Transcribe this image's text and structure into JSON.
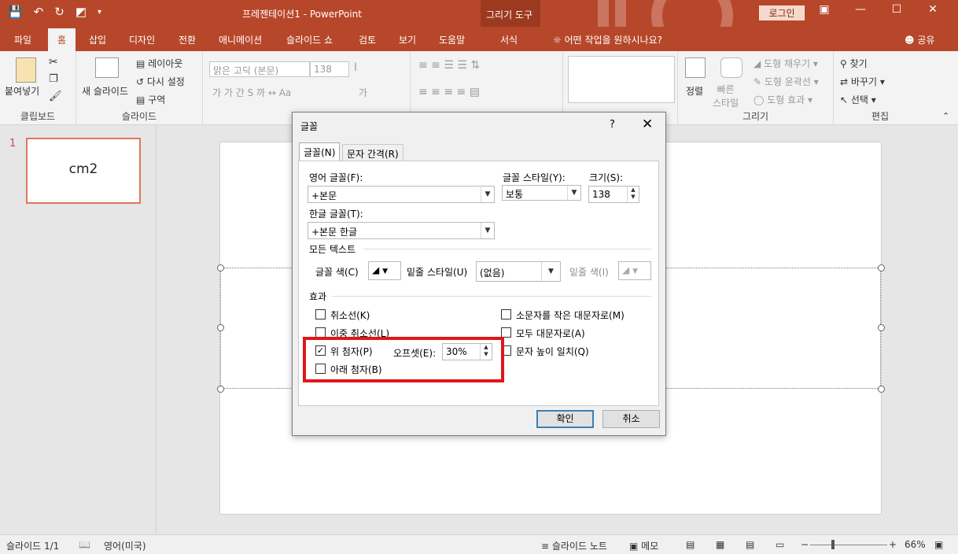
{
  "window": {
    "doc_title": "프레젠테이션1 - PowerPoint",
    "context_tab_group": "그리기 도구",
    "login_label": "로그인"
  },
  "tabs": [
    {
      "label": "파일"
    },
    {
      "label": "홈"
    },
    {
      "label": "삽입"
    },
    {
      "label": "디자인"
    },
    {
      "label": "전환"
    },
    {
      "label": "애니메이션"
    },
    {
      "label": "슬라이드 쇼"
    },
    {
      "label": "검토"
    },
    {
      "label": "보기"
    },
    {
      "label": "도움말"
    },
    {
      "label": "서식"
    }
  ],
  "tell_me": "어떤 작업을 원하시나요?",
  "share_label": "공유",
  "ribbon": {
    "clipboard": {
      "paste": "붙여넣기",
      "group": "클립보드"
    },
    "slides": {
      "new_slide": "새 슬라이드",
      "layout": "레이아웃",
      "reset": "다시 설정",
      "section": "구역",
      "group": "슬라이드"
    },
    "font": {
      "font_name": "맑은 고딕 (본문)",
      "font_size": "138"
    },
    "drawing": {
      "arrange": "정렬",
      "quick_styles": "빠른\n스타일",
      "shape_fill": "도형 채우기",
      "shape_outline": "도형 윤곽선",
      "shape_effects": "도형 효과",
      "group": "그리기"
    },
    "editing": {
      "find": "찾기",
      "replace": "바꾸기",
      "select": "선택",
      "group": "편집"
    }
  },
  "slide_pane": {
    "number": "1",
    "thumb_text": "cm2"
  },
  "status": {
    "slide_count": "슬라이드 1/1",
    "language": "영어(미국)",
    "notes": "슬라이드 노트",
    "comments": "메모",
    "zoom": "66%"
  },
  "dialog": {
    "title": "글꼴",
    "help": "?",
    "tabs": {
      "font": "글꼴(N)",
      "spacing": "문자 간격(R)"
    },
    "latin_font_label": "영어 글꼴(F):",
    "latin_font_value": "+본문",
    "style_label": "글꼴 스타일(Y):",
    "style_value": "보통",
    "size_label": "크기(S):",
    "size_value": "138",
    "asian_font_label": "한글 글꼴(T):",
    "asian_font_value": "+본문 한글",
    "all_text_label": "모든 텍스트",
    "font_color_label": "글꼴 색(C)",
    "underline_style_label": "밑줄 스타일(U)",
    "underline_style_value": "(없음)",
    "underline_color_label": "밑줄 색(I)",
    "effects_label": "효과",
    "effects": {
      "strikethrough": {
        "label": "취소선(K)",
        "checked": false
      },
      "double_strikethrough": {
        "label": "이중 취소선(L)",
        "checked": false
      },
      "superscript": {
        "label": "위 첨자(P)",
        "checked": true
      },
      "subscript": {
        "label": "아래 첨자(B)",
        "checked": false
      },
      "small_caps": {
        "label": "소문자를 작은 대문자로(M)",
        "checked": false
      },
      "all_caps": {
        "label": "모두 대문자로(A)",
        "checked": false
      },
      "equalize_height": {
        "label": "문자 높이 일치(Q)",
        "checked": false
      }
    },
    "offset_label": "오프셋(E):",
    "offset_value": "30%",
    "ok": "확인",
    "cancel": "취소"
  }
}
